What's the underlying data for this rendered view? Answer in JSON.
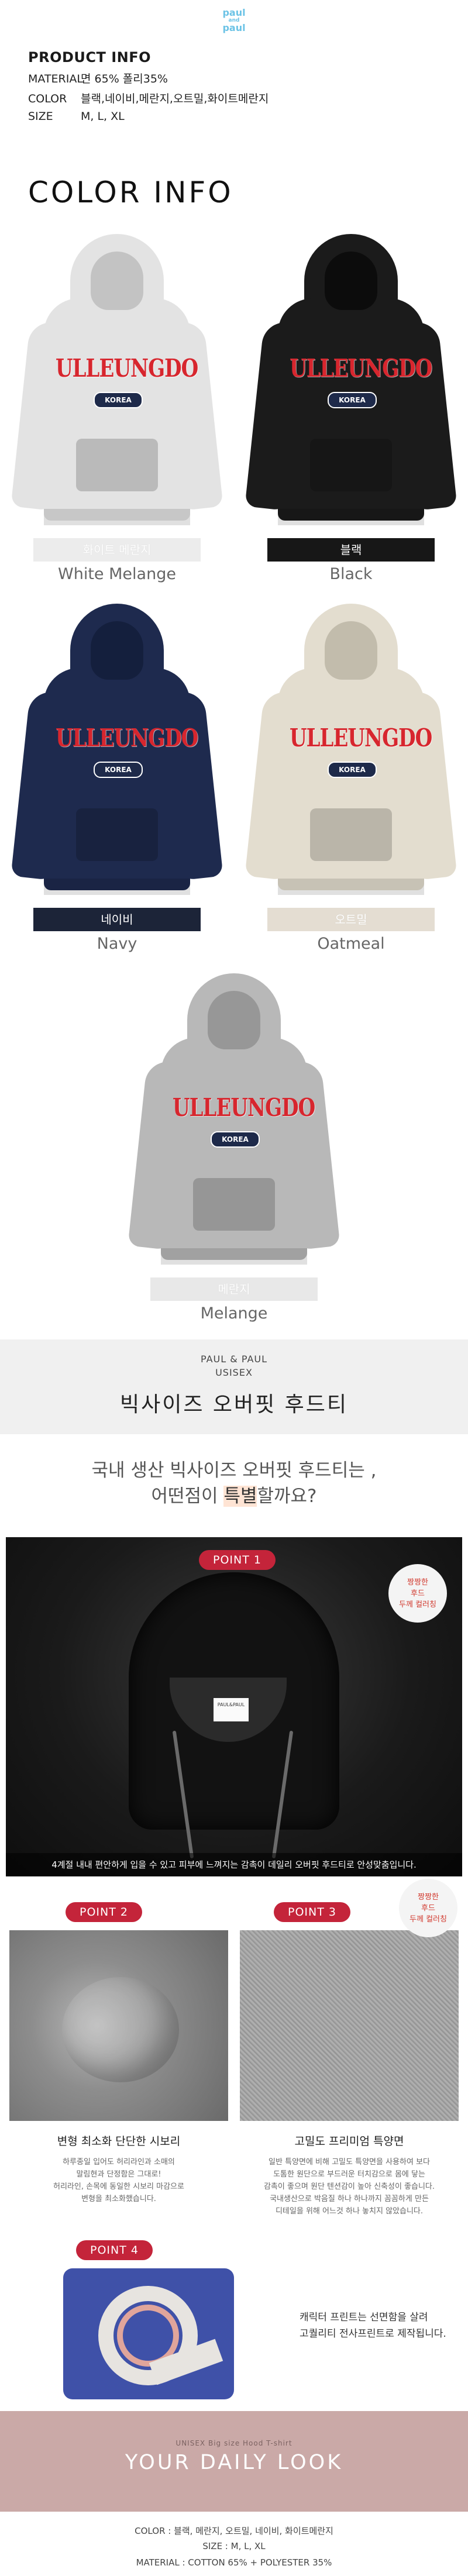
{
  "logo": {
    "top": "paul",
    "mid": "and",
    "bottom": "paul"
  },
  "product_info": {
    "title": "PRODUCT INFO",
    "rows": [
      {
        "key": "MATERIAL",
        "value": "면 65% 폴리35%"
      },
      {
        "key": "COLOR",
        "value": "블랙,네이비,메란지,오트밀,화이트메란지"
      },
      {
        "key": "SIZE",
        "value": "M, L, XL"
      }
    ]
  },
  "color_info": {
    "title": "COLOR INFO",
    "items": [
      {
        "ko": "화이트 메란지",
        "en": "White Melange",
        "body": "#e3e3e3",
        "bar": "#ececec"
      },
      {
        "ko": "블랙",
        "en": "Black",
        "body": "#1b1b1b",
        "bar": "#171717"
      },
      {
        "ko": "네이비",
        "en": "Navy",
        "body": "#1e2a4e",
        "bar": "#1c2438"
      },
      {
        "ko": "오트밀",
        "en": "Oatmeal",
        "body": "#e3ddcf",
        "bar": "#e4ddd2"
      },
      {
        "ko": "메란지",
        "en": "Melange",
        "body": "#b8b8b8",
        "bar": "#e8e8e8"
      }
    ],
    "print_text": "ULLEUNGDO",
    "print_badge": "KOREA"
  },
  "brand": {
    "name": "PAUL & PAUL",
    "gender": "USISEX",
    "product": "빅사이즈 오버핏 후드티"
  },
  "question": {
    "line1": "국내 생산 빅사이즈 오버핏 후드티는 ,",
    "line2_pre": "어떤점이 ",
    "line2_hl": "특별",
    "line2_post": "할까요?"
  },
  "point1": {
    "badge": "POINT 1",
    "circle": [
      "짱짱한",
      "후드",
      "두께 컬러칭"
    ],
    "tag": "PAUL&PAUL",
    "caption": "4계절 내내 편안하게 입을 수 있고 피부에 느껴지는 감촉이 데일리 오버핏 후드티로 안성맞춤입니다."
  },
  "point2": {
    "badge": "POINT 2",
    "title": "변형 최소화 단단한 시보리",
    "desc": [
      "하루종일 입어도 허리라인과 소매의",
      "말림현과 단정함은 그대로!",
      "허리라인, 손목에 동일한 시보리 마감으로",
      "변형을 최소화했습니다."
    ]
  },
  "point3": {
    "badge": "POINT 3",
    "circle": [
      "짱짱한",
      "후드",
      "두께 컬러칭"
    ],
    "title": "고밀도 프리미엄 특양면",
    "desc": [
      "일반 특양면에 비해 고밀도 특양면을 사용하여 보다",
      "도톰한 원단으로 부드러운 터치감으로 몸에 닿는",
      "감촉이 좋으며 원단 텐션감이 높아 신축성이 좋습니다.",
      "국내생산으로 박음질 하나 하나까지 꼼꼼하게 만든",
      "디테일을 위해 어느것 하나 놓치지 않았습니다."
    ]
  },
  "point4": {
    "badge": "POINT 4",
    "desc": [
      "캐릭터 프린트는 선면함을 살려",
      "고퀄리티 전사프린트로 제작됩니다."
    ]
  },
  "daily_look": {
    "subtitle": "UNISEX Big size Hood T-shirt",
    "title": "YOUR DAILY LOOK"
  },
  "spec": {
    "color": "COLOR : 블랙, 메란지, 오트밀, 네이비, 화이트메란지",
    "size": "SIZE : M, L, XL",
    "material": "MATERIAL : COTTON 65% + POLYESTER 35%"
  }
}
